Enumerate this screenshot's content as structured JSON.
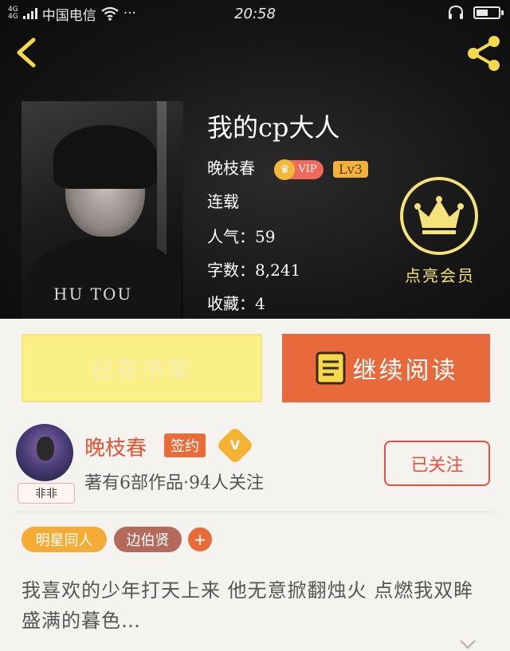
{
  "status_bar": {
    "network_small_top": "4G",
    "network_small_bottom": "4G",
    "carrier": "中国电信",
    "more": "···",
    "time": "20:58"
  },
  "book": {
    "title": "我的cp大人",
    "author": "晚枝春",
    "vip_label": "VIP",
    "level_label": "Lv3",
    "status": "连载",
    "popularity_label": "人气：",
    "popularity": "59",
    "word_count_label": "字数：",
    "word_count": "8,241",
    "favorites_label": "收藏：",
    "favorites": "4"
  },
  "member": {
    "label": "点亮会员"
  },
  "cover": {
    "shirt_text": "HU TOU"
  },
  "actions": {
    "shelf_label": "已在书架",
    "continue_label": "继续阅读"
  },
  "author_card": {
    "name": "晚枝春",
    "signed_label": "签约",
    "verified_label": "V",
    "badge_label": "非非",
    "works_text": "著有6部作品·94人关注",
    "follow_label": "已关注"
  },
  "tags": [
    {
      "label": "明星同人",
      "color": "#f4ac36"
    },
    {
      "label": "边伯贤",
      "color": "#b36a5a"
    }
  ],
  "add_tag_label": "+",
  "intro": "我喜欢的少年打天上来 他无意掀翻烛火 点燃我双眸盛满的暮色…",
  "colors": {
    "accent": "#e86a3c",
    "shelf_button": "#fbf086",
    "member_gold": "#f4e27a",
    "follow_red": "#e3503c"
  }
}
